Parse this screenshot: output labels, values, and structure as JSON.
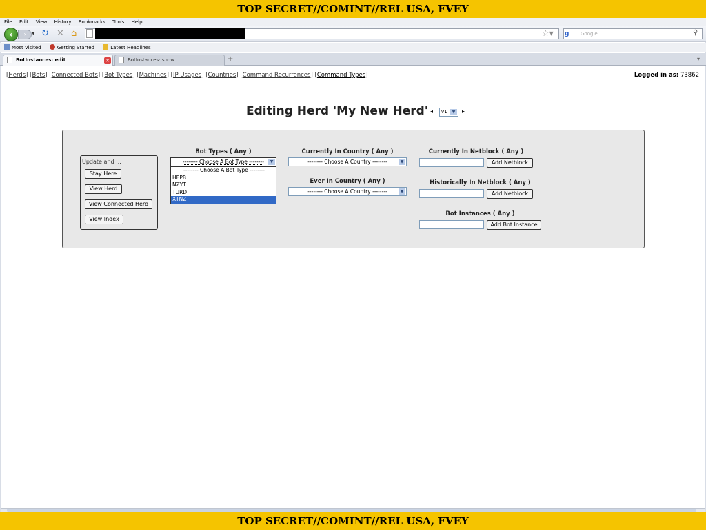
{
  "classification_banner": "TOP SECRET//COMINT//REL USA, FVEY",
  "browser": {
    "menu": [
      "File",
      "Edit",
      "View",
      "History",
      "Bookmarks",
      "Tools",
      "Help"
    ],
    "search_placeholder": "Google",
    "bookmarks": [
      "Most Visited",
      "Getting Started",
      "Latest Headlines"
    ],
    "tabs": [
      {
        "label": "BotInstances: edit",
        "active": true
      },
      {
        "label": "BotInstances: show",
        "active": false
      }
    ]
  },
  "app_nav": {
    "links": [
      "Herds",
      "Bots",
      "Connected Bots",
      "Bot Types",
      "Machines",
      "IP Usages",
      "Countries",
      "Command Recurrences",
      "Command Types"
    ]
  },
  "user": {
    "logged_in_label": "Logged in as:",
    "user_id": "73862"
  },
  "page": {
    "title": "Editing Herd 'My New Herd'",
    "version": "v1",
    "prev_arrow": "◂",
    "next_arrow": "▸"
  },
  "update_panel": {
    "label": "Update and ...",
    "buttons": [
      "Stay Here",
      "View Herd",
      "View Connected Herd",
      "View Index"
    ]
  },
  "bot_types": {
    "label": "Bot Types ( Any )",
    "selected": "-------- Choose A Bot Type --------",
    "options": [
      "-------- Choose A Bot Type --------",
      "HEPB",
      "NZYT",
      "TURD",
      "XTNZ"
    ],
    "highlighted": "XTNZ"
  },
  "current_country": {
    "label": "Currently In Country ( Any )",
    "selected": "-------- Choose A Country --------"
  },
  "ever_country": {
    "label": "Ever In Country ( Any )",
    "selected": "-------- Choose A Country --------"
  },
  "current_netblock": {
    "label": "Currently In Netblock ( Any )",
    "button": "Add Netblock",
    "value": ""
  },
  "historical_netblock": {
    "label": "Historically In Netblock ( Any )",
    "button": "Add Netblock",
    "value": ""
  },
  "bot_instances": {
    "label": "Bot Instances ( Any )",
    "button": "Add Bot Instance",
    "value": ""
  },
  "colors": {
    "banner": "#f5c400",
    "panel": "#e8e8e8",
    "selection": "#3169c6"
  }
}
